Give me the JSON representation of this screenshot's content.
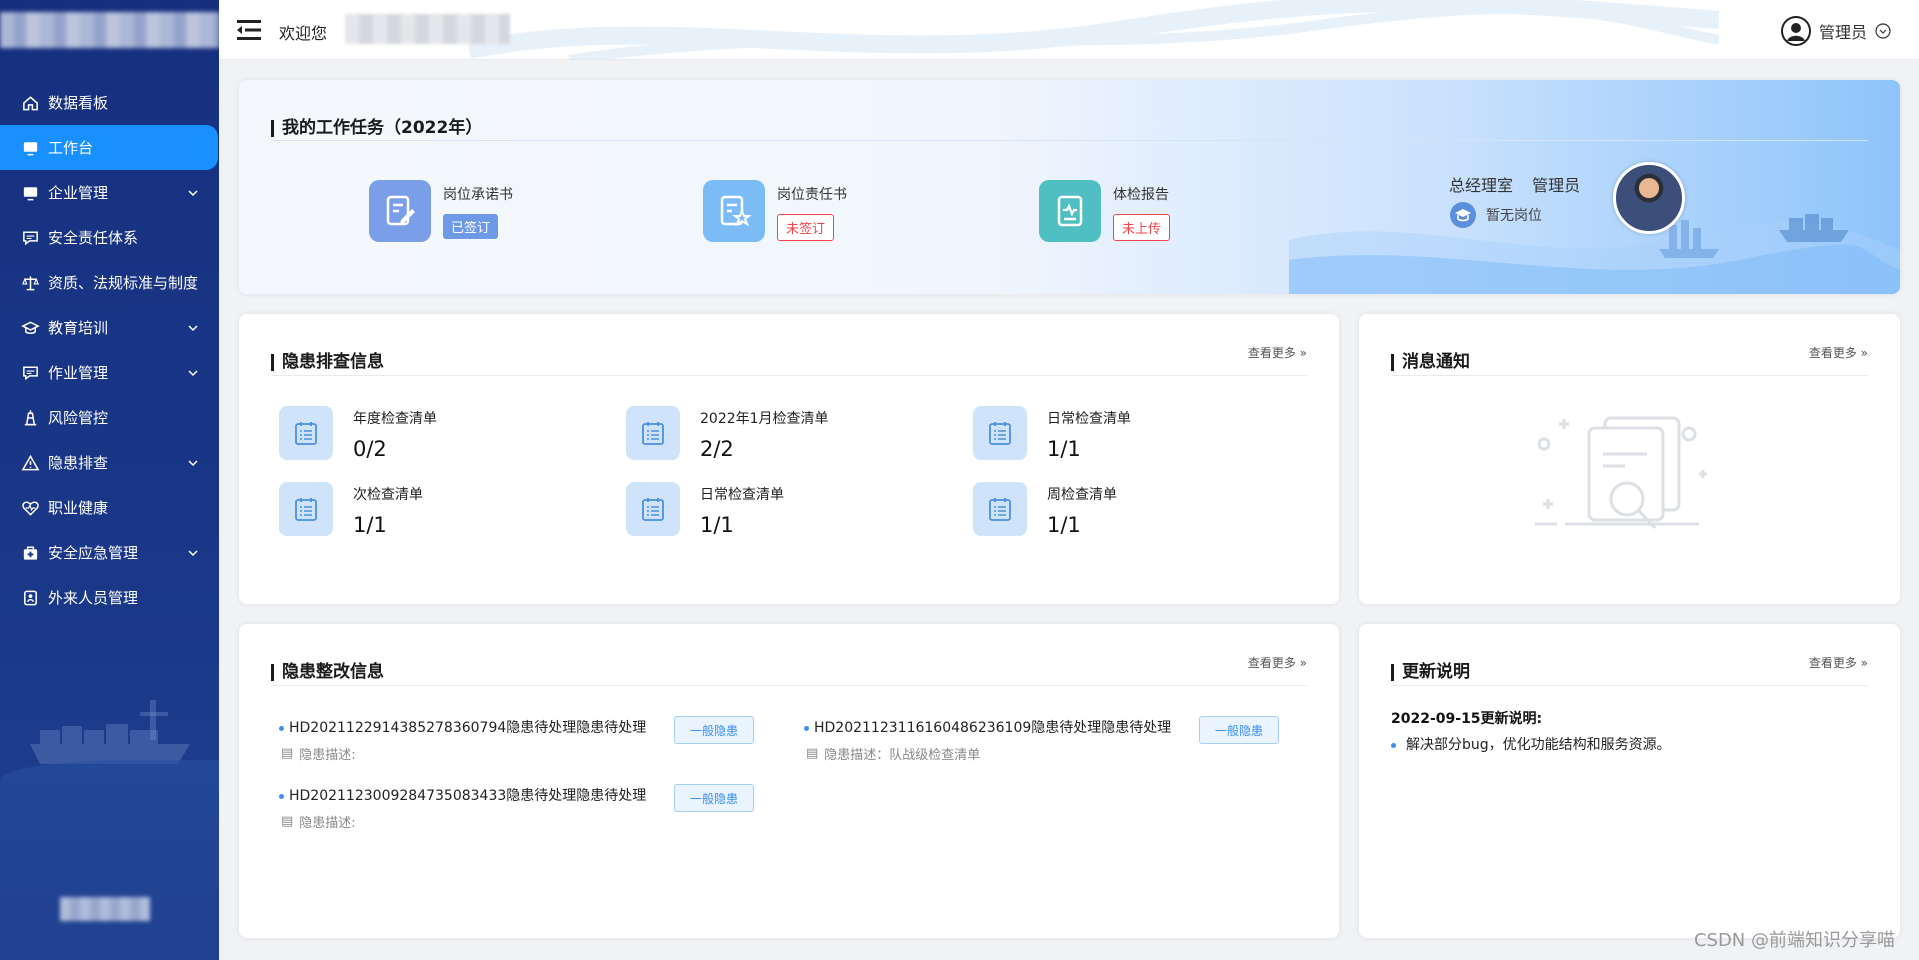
{
  "header": {
    "welcome": "欢迎您",
    "user_name": "管理员",
    "icons": {
      "menu": "menu-fold-icon",
      "avatar": "user-avatar-icon",
      "dropdown": "chevron-down-circle-icon"
    }
  },
  "sidebar": {
    "items": [
      {
        "label": "数据看板",
        "icon": "home-icon",
        "expandable": false,
        "active": false
      },
      {
        "label": "工作台",
        "icon": "monitor-icon",
        "expandable": false,
        "active": true
      },
      {
        "label": "企业管理",
        "icon": "monitor-icon",
        "expandable": true,
        "active": false
      },
      {
        "label": "安全责任体系",
        "icon": "chat-icon",
        "expandable": false,
        "active": false
      },
      {
        "label": "资质、法规标准与制度",
        "icon": "scale-icon",
        "expandable": false,
        "active": false
      },
      {
        "label": "教育培训",
        "icon": "graduation-icon",
        "expandable": true,
        "active": false
      },
      {
        "label": "作业管理",
        "icon": "chat-icon",
        "expandable": true,
        "active": false
      },
      {
        "label": "风险管控",
        "icon": "tower-icon",
        "expandable": false,
        "active": false
      },
      {
        "label": "隐患排查",
        "icon": "warning-icon",
        "expandable": true,
        "active": false
      },
      {
        "label": "职业健康",
        "icon": "heartbeat-icon",
        "expandable": false,
        "active": false
      },
      {
        "label": "安全应急管理",
        "icon": "kit-icon",
        "expandable": true,
        "active": false
      },
      {
        "label": "外来人员管理",
        "icon": "badge-icon",
        "expandable": false,
        "active": false
      }
    ]
  },
  "tasks": {
    "title": "我的工作任务（2022年）",
    "items": [
      {
        "label": "岗位承诺书",
        "status": "已签订",
        "icon": "edit-document-icon",
        "color": "#7b9ee8",
        "done": true
      },
      {
        "label": "岗位责任书",
        "status": "未签订",
        "icon": "document-star-icon",
        "color": "#7cbcf6",
        "done": false
      },
      {
        "label": "体检报告",
        "status": "未上传",
        "icon": "health-report-icon",
        "color": "#4fbfc3",
        "done": false
      }
    ],
    "profile": {
      "department": "总经理室 管理员",
      "position": "暂无岗位",
      "position_icon": "graduation-cap-icon"
    }
  },
  "inspection": {
    "title": "隐患排查信息",
    "more": "查看更多",
    "items": [
      {
        "label": "年度检查清单",
        "value": "0/2"
      },
      {
        "label": "2022年1月检查清单",
        "value": "2/2"
      },
      {
        "label": "日常检查清单",
        "value": "1/1"
      },
      {
        "label": "次检查清单",
        "value": "1/1"
      },
      {
        "label": "日常检查清单",
        "value": "1/1"
      },
      {
        "label": "周检查清单",
        "value": "1/1"
      }
    ]
  },
  "notice": {
    "title": "消息通知",
    "more": "查看更多",
    "empty_icon": "empty-document-search-icon"
  },
  "rectification": {
    "title": "隐患整改信息",
    "more": "查看更多",
    "items": [
      {
        "code": "HD202112291438527836079​4隐患待处理隐患待处理",
        "desc": "隐患描述:",
        "tag": "一般隐患"
      },
      {
        "code": "HD202112311616048623610​9隐患待处理隐患待处理",
        "desc": "隐患描述：队战级检查清单",
        "tag": "一般隐患"
      },
      {
        "code": "HD2021123009284735083433隐患待处理隐患待处理",
        "desc": "隐患描述:",
        "tag": "一般隐患"
      }
    ]
  },
  "updates": {
    "title": "更新说明",
    "more": "查看更多",
    "date": "2022-09-15更新说明:",
    "items": [
      "解决部分bug，优化功能结构和服务资源。"
    ]
  },
  "watermark": "CSDN @前端知识分享喵",
  "colors": {
    "sidebar": "#16307e",
    "active": "#1890ff",
    "accent": "#3f8ef5",
    "danger": "#f0464a"
  }
}
